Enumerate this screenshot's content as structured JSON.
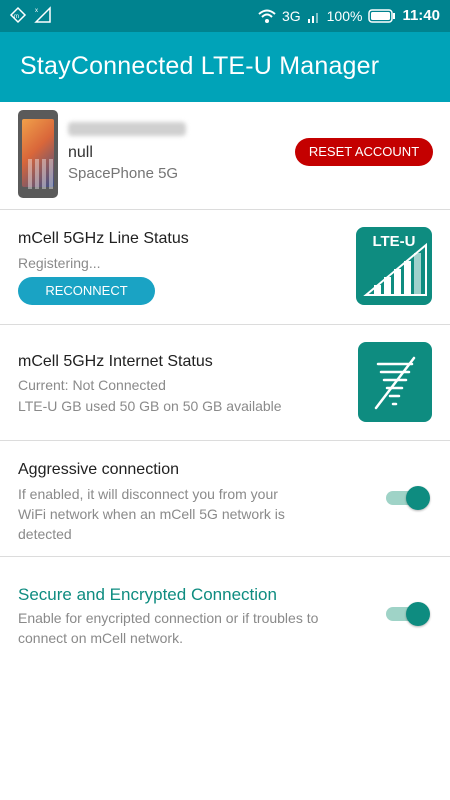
{
  "status_bar": {
    "network": "3G",
    "battery": "100%",
    "time": "11:40"
  },
  "app_bar": {
    "title": "StayConnected LTE-U Manager"
  },
  "device": {
    "line1": "null",
    "model": "SpacePhone 5G",
    "reset_button": "RESET ACCOUNT",
    "reset_color": "#c40000"
  },
  "line_status": {
    "title": "mCell 5GHz Line Status",
    "status": "Registering...",
    "reconnect_button": "RECONNECT",
    "tile_label": "LTE-U",
    "tile_icon": "signal-bars-icon"
  },
  "internet_status": {
    "title": "mCell 5GHz Internet Status",
    "current": "Current: Not Connected",
    "usage": "LTE-U GB used 50 GB on 50 GB available",
    "tile_icon": "tornado-crossed-icon"
  },
  "aggressive": {
    "title": "Aggressive connection",
    "description": "If enabled, it will disconnect you from your WiFi network when an mCell 5G network is detected",
    "enabled": true
  },
  "secure": {
    "title": "Secure and Encrypted Connection",
    "description": "Enable for enycripted connection or if troubles to connect on mCell network.",
    "enabled": true
  },
  "colors": {
    "status_bar": "#00838f",
    "app_bar": "#00a3b8",
    "accent": "#0e8c80",
    "reconnect": "#1aa3c4"
  }
}
